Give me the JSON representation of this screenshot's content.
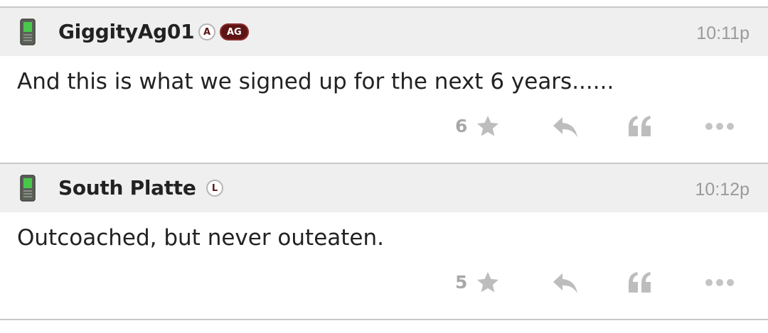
{
  "posts": [
    {
      "username": "GiggityAg01",
      "badges": [
        "A",
        "AG"
      ],
      "time": "10:11p",
      "body": "And this is what we signed up for the next 6 years......",
      "likes": "6",
      "device_icon": "phone-icon"
    },
    {
      "username": "South Platte",
      "badges": [
        "L"
      ],
      "time": "10:12p",
      "body": "Outcoached, but never outeaten.",
      "likes": "5",
      "device_icon": "phone-icon"
    }
  ],
  "colors": {
    "header_bg": "#efefef",
    "badge_maroon": "#5c1414",
    "muted_gray": "#a8a8a8"
  },
  "icons": [
    "phone-icon",
    "star-icon",
    "reply-icon",
    "quote-icon",
    "more-icon"
  ]
}
